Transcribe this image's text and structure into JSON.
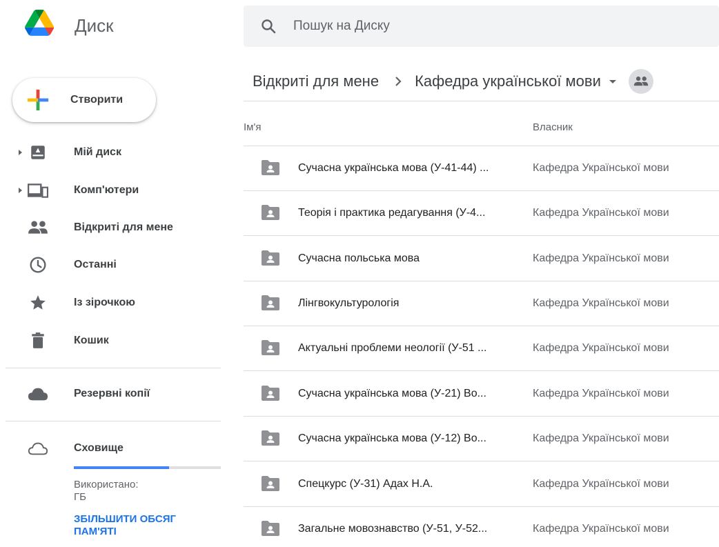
{
  "app": {
    "title": "Диск",
    "search_placeholder": "Пошук на Диску",
    "accent_color": "#1a73e8"
  },
  "create_button": {
    "label": "Створити"
  },
  "sidebar": {
    "items": [
      {
        "label": "Мій диск",
        "icon": "drive-icon",
        "expandable": true
      },
      {
        "label": "Комп'ютери",
        "icon": "computers-icon",
        "expandable": true
      },
      {
        "label": "Відкриті для мене",
        "icon": "shared-people-icon",
        "expandable": false
      },
      {
        "label": "Останні",
        "icon": "clock-icon",
        "expandable": false
      },
      {
        "label": "Із зірочкою",
        "icon": "star-icon",
        "expandable": false
      },
      {
        "label": "Кошик",
        "icon": "trash-icon",
        "expandable": false
      },
      {
        "label": "Резервні копії",
        "icon": "cloud-filled-icon",
        "expandable": false
      },
      {
        "label": "Сховище",
        "icon": "cloud-outline-icon",
        "expandable": false
      }
    ],
    "storage": {
      "used_label": "Використано:",
      "used_units": "ГБ",
      "used_fraction": 0.65,
      "upgrade_line1": "ЗБІЛЬШИТИ ОБСЯГ",
      "upgrade_line2": "ПАМ'ЯТІ"
    }
  },
  "breadcrumb": {
    "parent": "Відкриті для мене",
    "current": "Кафедра української мови"
  },
  "table": {
    "columns": {
      "name": "Ім'я",
      "owner": "Власник"
    },
    "rows": [
      {
        "name": "Сучасна українська мова (У-41-44) ...",
        "owner": "Кафедра Української мови"
      },
      {
        "name": "Теорія і практика редагування (У-4...",
        "owner": "Кафедра Української мови"
      },
      {
        "name": "Сучасна польська мова",
        "owner": "Кафедра Української мови"
      },
      {
        "name": "Лінгвокультурологія",
        "owner": "Кафедра Української мови"
      },
      {
        "name": "Актуальні проблеми неології (У-51 ...",
        "owner": "Кафедра Української мови"
      },
      {
        "name": "Сучасна українська мова (У-21) Во...",
        "owner": "Кафедра Української мови"
      },
      {
        "name": "Сучасна українська мова (У-12) Во...",
        "owner": "Кафедра Української мови"
      },
      {
        "name": "Спецкурс (У-31) Адах Н.А.",
        "owner": "Кафедра Української мови"
      },
      {
        "name": "Загальне мовознавство (У-51, У-52...",
        "owner": "Кафедра Української мови"
      }
    ]
  }
}
